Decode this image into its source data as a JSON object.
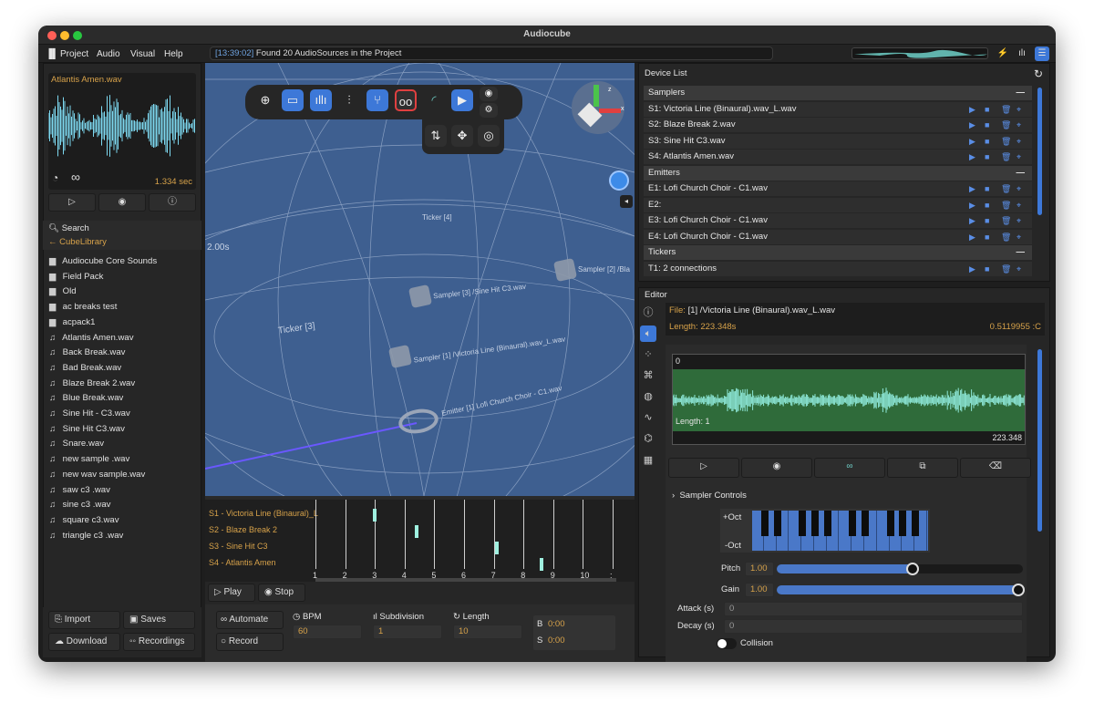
{
  "window": {
    "title": "Audiocube"
  },
  "menu": {
    "items": [
      "Project",
      "Audio",
      "Visual",
      "Help"
    ]
  },
  "status": {
    "timestamp": "[13:39:02]",
    "message": "Found 20 AudioSources in the Project"
  },
  "preview": {
    "filename": "Atlantis Amen.wav",
    "duration": "1.334 sec"
  },
  "library": {
    "search_label": "Search",
    "back_label": "CubeLibrary",
    "folders": [
      "Audiocube Core Sounds",
      "Field Pack",
      "Old",
      "ac breaks test",
      "acpack1"
    ],
    "files": [
      "Atlantis Amen.wav",
      "Back Break.wav",
      "Bad Break.wav",
      "Blaze Break 2.wav",
      "Blue Break.wav",
      "Sine Hit - C3.wav",
      "Sine Hit C3.wav",
      "Snare.wav",
      "new sample .wav",
      "new wav sample.wav",
      "saw c3 .wav",
      "sine c3 .wav",
      "square c3.wav",
      "triangle c3 .wav"
    ]
  },
  "bottom_left": {
    "import": "Import",
    "saves": "Saves",
    "download": "Download",
    "recordings": "Recordings"
  },
  "viewport": {
    "labels": {
      "ticker4": "Ticker [4]",
      "ticker3": "Ticker [3]",
      "time": "2.00s",
      "sampler2": "Sampler [2] /Bla",
      "sampler3": "Sampler [3] /Sine Hit C3.wav",
      "sampler1": "Sampler [1] /Victoria Line (Binaural).wav_L.wav",
      "emitter1": "Emitter [1] Lofi Church Choir - C1.wav"
    }
  },
  "sequencer": {
    "tracks": [
      "S1 - Victoria Line (Binaural)_L",
      "S2 - Blaze Break 2",
      "S3 - Sine Hit C3",
      "S4 - Atlantis Amen"
    ],
    "steps": [
      "1",
      "2",
      "3",
      "4",
      "5",
      "6",
      "7",
      "8",
      "9",
      "10",
      ":"
    ],
    "notes": [
      {
        "track": 0,
        "step": 3
      },
      {
        "track": 1,
        "step": 4.4
      },
      {
        "track": 2,
        "step": 7.1
      },
      {
        "track": 3,
        "step": 8.6
      }
    ]
  },
  "transport": {
    "play": "Play",
    "stop": "Stop",
    "automate": "Automate",
    "record": "Record",
    "bpm_label": "BPM",
    "bpm": "60",
    "subdivision_label": "Subdivision",
    "subdivision": "1",
    "length_label": "Length",
    "length": "10",
    "b_label": "B",
    "b_value": "0:00",
    "s_label": "S",
    "s_value": "0:00"
  },
  "device_list": {
    "title": "Device List",
    "groups": [
      {
        "name": "Samplers",
        "items": [
          "S1: Victoria Line (Binaural).wav_L.wav",
          "S2: Blaze Break 2.wav",
          "S3: Sine Hit C3.wav",
          "S4: Atlantis Amen.wav"
        ]
      },
      {
        "name": "Emitters",
        "items": [
          "E1: Lofi Church Choir - C1.wav",
          "E2:",
          "E3: Lofi Church Choir - C1.wav",
          "E4: Lofi Church Choir - C1.wav"
        ]
      },
      {
        "name": "Tickers",
        "items": [
          "T1: 2 connections"
        ]
      }
    ]
  },
  "editor": {
    "title": "Editor",
    "file_label": "File:",
    "file": "[1] /Victoria Line (Binaural).wav_L.wav",
    "length_label": "Length: 223.348s",
    "value_right": "0.5119955 :C",
    "wave_start": "0",
    "wave_length": "Length: 1",
    "wave_end": "223.348",
    "sampler_controls": "Sampler Controls",
    "oct_up": "+Oct",
    "oct_down": "-Oct",
    "pitch_label": "Pitch",
    "pitch": "1.00",
    "pitch_level": 0.55,
    "gain_label": "Gain",
    "gain": "1.00",
    "gain_level": 0.98,
    "attack_label": "Attack (s)",
    "attack": "0",
    "decay_label": "Decay (s)",
    "decay": "0",
    "collision_label": "Collision"
  },
  "colors": {
    "accent": "#3d78d8",
    "orange": "#d7a24a",
    "viewport": "#3e5f90",
    "wave_cyan": "#7dd8ef",
    "wave_green": "#2f6b3a"
  }
}
